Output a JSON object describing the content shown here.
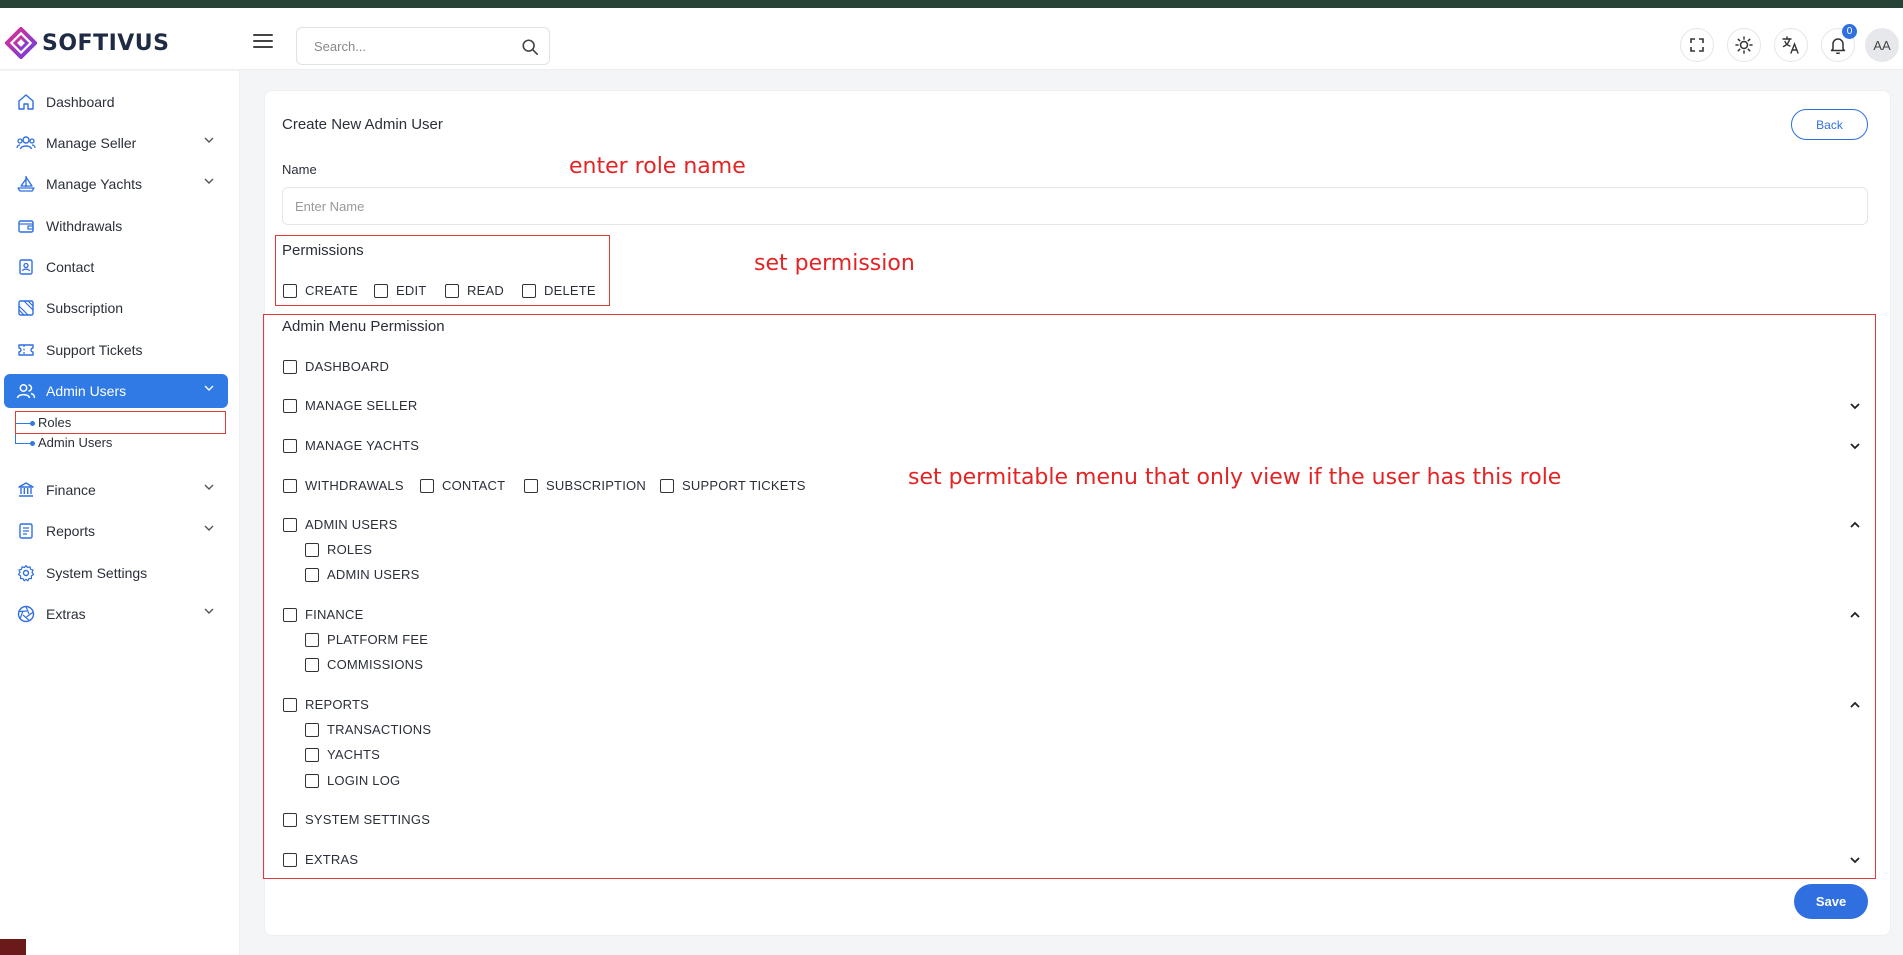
{
  "brand": {
    "name": "SOFTIVUS"
  },
  "colors": {
    "primary": "#2f6fe0",
    "annotation": "#e42424",
    "sidebar_active": "#2f7ae5"
  },
  "header": {
    "search_placeholder": "Search...",
    "notifications_count": "0",
    "avatar_initials": "AA",
    "icons": [
      "fullscreen-icon",
      "sun-icon",
      "translate-icon",
      "bell-icon"
    ]
  },
  "sidebar": {
    "items": [
      {
        "label": "Dashboard",
        "icon": "home-icon"
      },
      {
        "label": "Manage Seller",
        "icon": "users-icon"
      },
      {
        "label": "Manage Yachts",
        "icon": "sailboat-icon"
      },
      {
        "label": "Withdrawals",
        "icon": "wallet-icon"
      },
      {
        "label": "Contact",
        "icon": "contact-icon"
      },
      {
        "label": "Subscription",
        "icon": "subscription-icon"
      },
      {
        "label": "Support Tickets",
        "icon": "ticket-icon"
      },
      {
        "label": "Admin Users",
        "icon": "admin-users-icon"
      },
      {
        "label": "Finance",
        "icon": "bank-icon"
      },
      {
        "label": "Reports",
        "icon": "report-icon"
      },
      {
        "label": "System Settings",
        "icon": "gear-icon"
      },
      {
        "label": "Extras",
        "icon": "aperture-icon"
      }
    ],
    "admin_sub": [
      "Roles",
      "Admin Users"
    ]
  },
  "form": {
    "title": "Create New Admin User",
    "back_label": "Back",
    "name_label": "Name",
    "name_placeholder": "Enter Name",
    "permissions_title": "Permissions",
    "permissions": [
      "CREATE",
      "EDIT",
      "READ",
      "DELETE"
    ],
    "menu_title": "Admin Menu Permission",
    "menu": {
      "dashboard": "DASHBOARD",
      "manage_seller": "MANAGE SELLER",
      "manage_yachts": "MANAGE YACHTS",
      "withdrawals": "WITHDRAWALS",
      "contact": "CONTACT",
      "subscription": "SUBSCRIPTION",
      "support_tickets": "SUPPORT TICKETS",
      "admin_users": "ADMIN USERS",
      "admin_children": [
        "ROLES",
        "ADMIN USERS"
      ],
      "finance": "FINANCE",
      "finance_children": [
        "PLATFORM FEE",
        "COMMISSIONS"
      ],
      "reports": "REPORTS",
      "reports_children": [
        "TRANSACTIONS",
        "YACHTS",
        "LOGIN LOG"
      ],
      "system_settings": "SYSTEM SETTINGS",
      "extras": "EXTRAS"
    },
    "save_label": "Save"
  },
  "annotations": {
    "name_note": "enter role name",
    "permission_note": "set permission",
    "menu_note": "set permitable menu that only view if the user has this role"
  }
}
